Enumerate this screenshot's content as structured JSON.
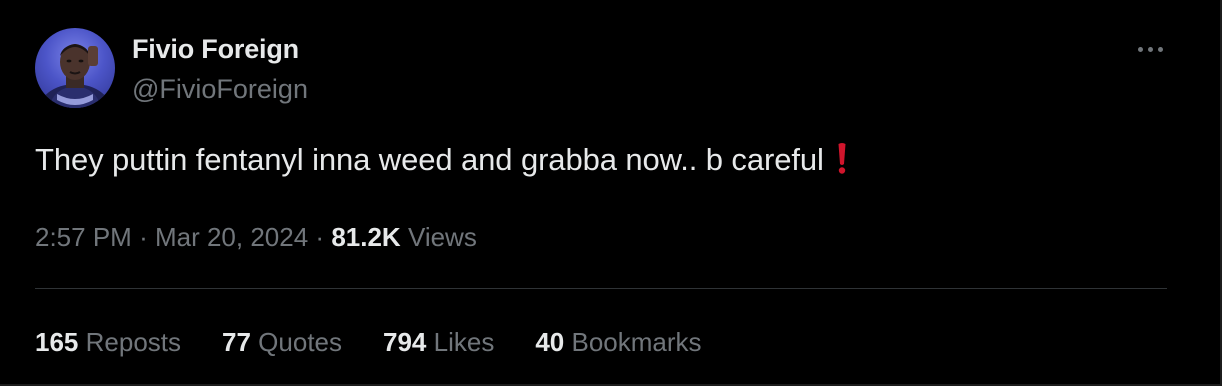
{
  "author": {
    "display_name": "Fivio Foreign",
    "handle": "@FivioForeign",
    "avatar_icon": "profile-photo"
  },
  "tweet": {
    "text": "They puttin fentanyl inna weed and grabba now.. b careful",
    "emoji_icon": "red-exclamation-mark"
  },
  "meta": {
    "time": "2:57 PM",
    "separator": "·",
    "date": "Mar 20, 2024",
    "views_count": "81.2K",
    "views_label": "Views"
  },
  "stats": [
    {
      "count": "165",
      "label": "Reposts"
    },
    {
      "count": "77",
      "label": "Quotes"
    },
    {
      "count": "794",
      "label": "Likes"
    },
    {
      "count": "40",
      "label": "Bookmarks"
    }
  ],
  "colors": {
    "background": "#000000",
    "primary_text": "#e7e9ea",
    "secondary_text": "#71767b",
    "divider": "#2f3336",
    "emoji_red": "#d0152c"
  }
}
